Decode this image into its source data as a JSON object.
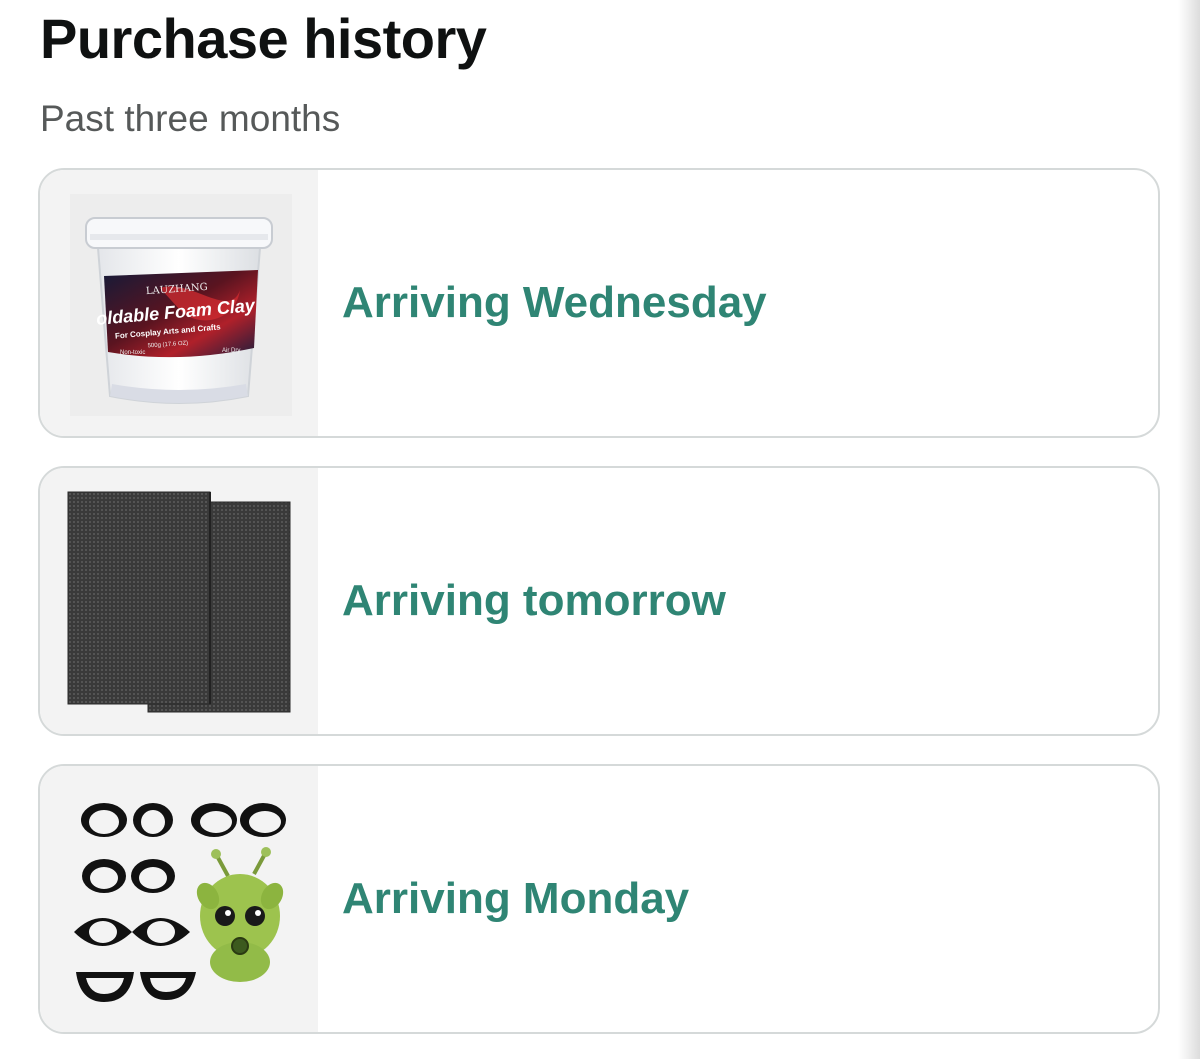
{
  "page": {
    "title": "Purchase history",
    "subtitle": "Past three months"
  },
  "orders": [
    {
      "status": "Arriving Wednesday",
      "product_image": {
        "brand_text": "LAUZHANG",
        "product_line": "oldable Foam Clay",
        "tagline": "For Cosplay Arts and Crafts",
        "weight": "500g (17.6 OZ)",
        "left_note": "Non-toxic",
        "right_note": "Air Dry"
      }
    },
    {
      "status": "Arriving tomorrow"
    },
    {
      "status": "Arriving Monday"
    }
  ],
  "colors": {
    "status_green": "#2f8574",
    "title": "#0f1111",
    "subtitle": "#565959",
    "card_border": "#d5d9d9",
    "thumb_bg": "#f3f3f3"
  }
}
